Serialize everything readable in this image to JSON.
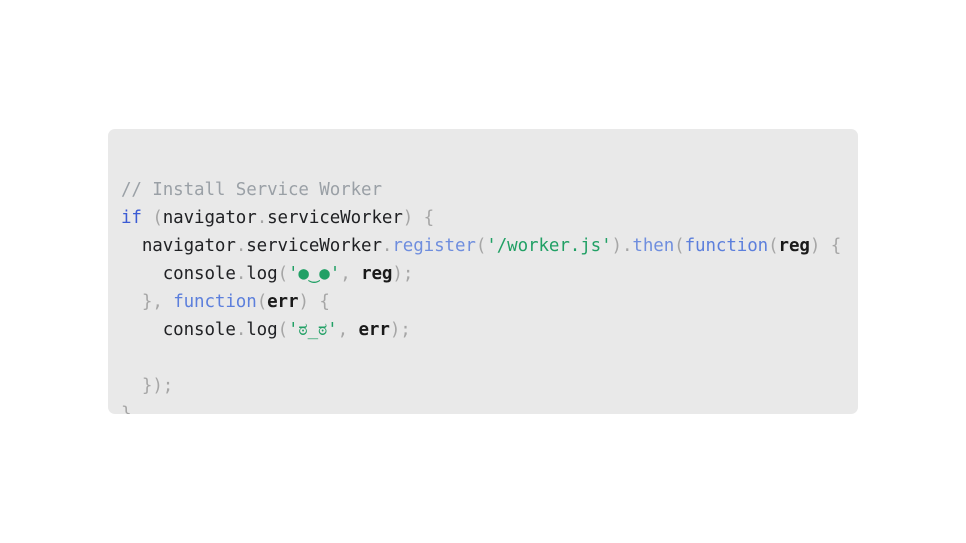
{
  "slide": {
    "background_color": "#ffffff"
  },
  "code_card": {
    "background_color": "#e9e9e9",
    "corner_radius": "7px",
    "language": "javascript",
    "colors": {
      "comment": "#9aa0a6",
      "keyword": "#3b5bd4",
      "method": "#6f8ede",
      "function_keyword": "#5c7fdc",
      "string": "#21a065",
      "punctuation": "#a6a6a6",
      "plain_text": "#202124",
      "parameter": "#1a1a1a"
    },
    "lines": [
      {
        "id": "line-1",
        "text": "// Install Service Worker",
        "tokens": [
          {
            "t": "// Install Service Worker",
            "c": "tok-comment"
          }
        ]
      },
      {
        "id": "line-2",
        "text": "if (navigator.serviceWorker) {",
        "tokens": [
          {
            "t": "if",
            "c": "tok-keyword"
          },
          {
            "t": " ",
            "c": "tok-plain"
          },
          {
            "t": "(",
            "c": "tok-punct"
          },
          {
            "t": "navigator",
            "c": "tok-ident"
          },
          {
            "t": ".",
            "c": "tok-dot"
          },
          {
            "t": "serviceWorker",
            "c": "tok-ident"
          },
          {
            "t": ")",
            "c": "tok-punct"
          },
          {
            "t": " ",
            "c": "tok-plain"
          },
          {
            "t": "{",
            "c": "tok-punct"
          }
        ]
      },
      {
        "id": "line-3",
        "text": "  navigator.serviceWorker.register('/worker.js').then(function(reg) {",
        "tokens": [
          {
            "t": "  ",
            "c": "tok-plain"
          },
          {
            "t": "navigator",
            "c": "tok-ident"
          },
          {
            "t": ".",
            "c": "tok-dot"
          },
          {
            "t": "serviceWorker",
            "c": "tok-ident"
          },
          {
            "t": ".",
            "c": "tok-dot"
          },
          {
            "t": "register",
            "c": "tok-method"
          },
          {
            "t": "(",
            "c": "tok-punct"
          },
          {
            "t": "'/worker.js'",
            "c": "tok-string"
          },
          {
            "t": ")",
            "c": "tok-punct"
          },
          {
            "t": ".",
            "c": "tok-dot"
          },
          {
            "t": "then",
            "c": "tok-method"
          },
          {
            "t": "(",
            "c": "tok-punct"
          },
          {
            "t": "function",
            "c": "tok-func"
          },
          {
            "t": "(",
            "c": "tok-punct"
          },
          {
            "t": "reg",
            "c": "tok-param"
          },
          {
            "t": ")",
            "c": "tok-punct"
          },
          {
            "t": " ",
            "c": "tok-plain"
          },
          {
            "t": "{",
            "c": "tok-punct"
          }
        ]
      },
      {
        "id": "line-4",
        "text": "    console.log('●‿●', reg);",
        "tokens": [
          {
            "t": "    ",
            "c": "tok-plain"
          },
          {
            "t": "console",
            "c": "tok-ident"
          },
          {
            "t": ".",
            "c": "tok-dot"
          },
          {
            "t": "log",
            "c": "tok-ident"
          },
          {
            "t": "(",
            "c": "tok-punct"
          },
          {
            "t": "'●‿●'",
            "c": "tok-face"
          },
          {
            "t": ",",
            "c": "tok-punct"
          },
          {
            "t": " ",
            "c": "tok-plain"
          },
          {
            "t": "reg",
            "c": "tok-param"
          },
          {
            "t": ")",
            "c": "tok-punct"
          },
          {
            "t": ";",
            "c": "tok-punct"
          }
        ]
      },
      {
        "id": "line-5",
        "text": "  }, function(err) {",
        "tokens": [
          {
            "t": "  ",
            "c": "tok-plain"
          },
          {
            "t": "}",
            "c": "tok-punct"
          },
          {
            "t": ",",
            "c": "tok-punct"
          },
          {
            "t": " ",
            "c": "tok-plain"
          },
          {
            "t": "function",
            "c": "tok-func"
          },
          {
            "t": "(",
            "c": "tok-punct"
          },
          {
            "t": "err",
            "c": "tok-param"
          },
          {
            "t": ")",
            "c": "tok-punct"
          },
          {
            "t": " ",
            "c": "tok-plain"
          },
          {
            "t": "{",
            "c": "tok-punct"
          }
        ]
      },
      {
        "id": "line-6",
        "text": "    console.log('ಠ_ಠ', err);",
        "tokens": [
          {
            "t": "    ",
            "c": "tok-plain"
          },
          {
            "t": "console",
            "c": "tok-ident"
          },
          {
            "t": ".",
            "c": "tok-dot"
          },
          {
            "t": "log",
            "c": "tok-ident"
          },
          {
            "t": "(",
            "c": "tok-punct"
          },
          {
            "t": "'ಠ_ಠ'",
            "c": "tok-face"
          },
          {
            "t": ",",
            "c": "tok-punct"
          },
          {
            "t": " ",
            "c": "tok-plain"
          },
          {
            "t": "err",
            "c": "tok-param"
          },
          {
            "t": ")",
            "c": "tok-punct"
          },
          {
            "t": ";",
            "c": "tok-punct"
          }
        ]
      },
      {
        "id": "line-7",
        "text": "",
        "tokens": []
      },
      {
        "id": "line-8",
        "text": "  });",
        "tokens": [
          {
            "t": "  ",
            "c": "tok-plain"
          },
          {
            "t": "}",
            "c": "tok-punct"
          },
          {
            "t": ")",
            "c": "tok-punct"
          },
          {
            "t": ";",
            "c": "tok-punct"
          }
        ]
      },
      {
        "id": "line-9",
        "text": "}",
        "tokens": [
          {
            "t": "}",
            "c": "tok-punct"
          }
        ]
      }
    ]
  }
}
